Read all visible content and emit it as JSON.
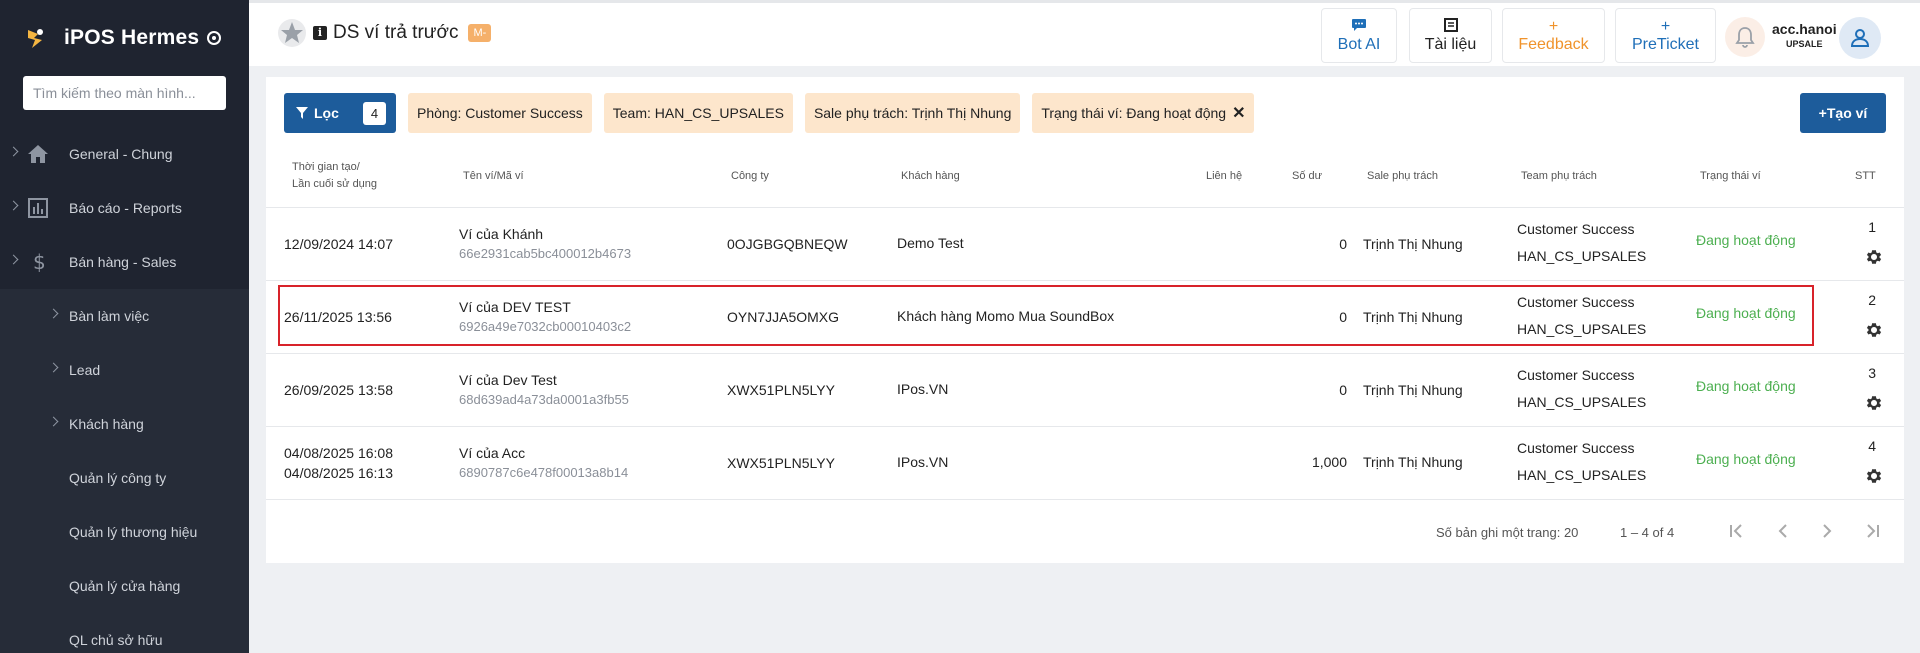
{
  "sidebar": {
    "brand": "iPOS Hermes",
    "search_placeholder": "Tìm kiếm theo màn hình...",
    "items": [
      {
        "label": "General - Chung"
      },
      {
        "label": "Báo cáo - Reports"
      },
      {
        "label": "Bán hàng - Sales"
      },
      {
        "label": "Bàn làm việc"
      },
      {
        "label": "Lead"
      },
      {
        "label": "Khách hàng"
      },
      {
        "label": "Quản lý công ty"
      },
      {
        "label": "Quản lý thương hiệu"
      },
      {
        "label": "Quản lý cửa hàng"
      },
      {
        "label": "QL chủ sở hữu"
      }
    ]
  },
  "header": {
    "title": "DS ví trả trước",
    "badge": "M-",
    "buttons": {
      "bot": "Bot AI",
      "docs": "Tài liệu",
      "feedback": "Feedback",
      "preticket": "PreTicket"
    },
    "account": {
      "name": "acc.hanoi",
      "role": "UPSALE"
    }
  },
  "filters": {
    "button_label": "Lọc",
    "count": "4",
    "chips": [
      "Phòng: Customer Success",
      "Team: HAN_CS_UPSALES",
      "Sale phụ trách: Trịnh Thị Nhung",
      "Trạng thái ví: Đang hoạt động"
    ],
    "create_label": "Tạo ví"
  },
  "table": {
    "headers": {
      "created_1": "Thời gian tạo/",
      "created_2": "Lần cuối sử dụng",
      "wallet": "Tên ví/Mã ví",
      "company": "Công ty",
      "customer": "Khách hàng",
      "contact": "Liên hệ",
      "balance": "Số dư",
      "sale": "Sale phụ trách",
      "team": "Team phụ trách",
      "status": "Trạng thái ví",
      "stt": "STT"
    },
    "rows": [
      {
        "created": "12/09/2024 14:07",
        "last_used": "",
        "wallet_name": "Ví của Khánh",
        "wallet_id": "66e2931cab5bc400012b4673",
        "company": "0OJGBGQBNEQW",
        "customer": "Demo Test",
        "balance": "0",
        "sale": "Trịnh Thị Nhung",
        "team_1": "Customer Success",
        "team_2": "HAN_CS_UPSALES",
        "status": "Đang hoạt động",
        "stt": "1"
      },
      {
        "created": "26/11/2025 13:56",
        "last_used": "",
        "wallet_name": "Ví của DEV TEST",
        "wallet_id": "6926a49e7032cb00010403c2",
        "company": "OYN7JJA5OMXG",
        "customer": "Khách hàng Momo Mua SoundBox",
        "balance": "0",
        "sale": "Trịnh Thị Nhung",
        "team_1": "Customer Success",
        "team_2": "HAN_CS_UPSALES",
        "status": "Đang hoạt động",
        "stt": "2"
      },
      {
        "created": "26/09/2025 13:58",
        "last_used": "",
        "wallet_name": "Ví của Dev Test",
        "wallet_id": "68d639ad4a73da0001a3fb55",
        "company": "XWX51PLN5LYY",
        "customer": "IPos.VN",
        "balance": "0",
        "sale": "Trịnh Thị Nhung",
        "team_1": "Customer Success",
        "team_2": "HAN_CS_UPSALES",
        "status": "Đang hoạt động",
        "stt": "3"
      },
      {
        "created": "04/08/2025 16:08",
        "last_used": "04/08/2025 16:13",
        "wallet_name": "Ví của Acc",
        "wallet_id": "6890787c6e478f00013a8b14",
        "company": "XWX51PLN5LYY",
        "customer": "IPos.VN",
        "balance": "1,000",
        "sale": "Trịnh Thị Nhung",
        "team_1": "Customer Success",
        "team_2": "HAN_CS_UPSALES",
        "status": "Đang hoạt động",
        "stt": "4"
      }
    ]
  },
  "pagination": {
    "page_size_label": "Số bản ghi một trang:",
    "page_size": "20",
    "range": "1 – 4 of 4"
  },
  "colors": {
    "sidebar_bg": "#1f2430",
    "primary": "#1d5c9b",
    "chip_bg": "#fde6cc",
    "status_green": "#4caf50",
    "highlight_red": "#d8232a",
    "feedback_orange": "#f0932b"
  },
  "icons": {
    "brand": "hermes-logo-icon",
    "filter": "filter-icon",
    "gear": "gear-icon",
    "bell": "bell-icon",
    "user": "user-icon"
  }
}
